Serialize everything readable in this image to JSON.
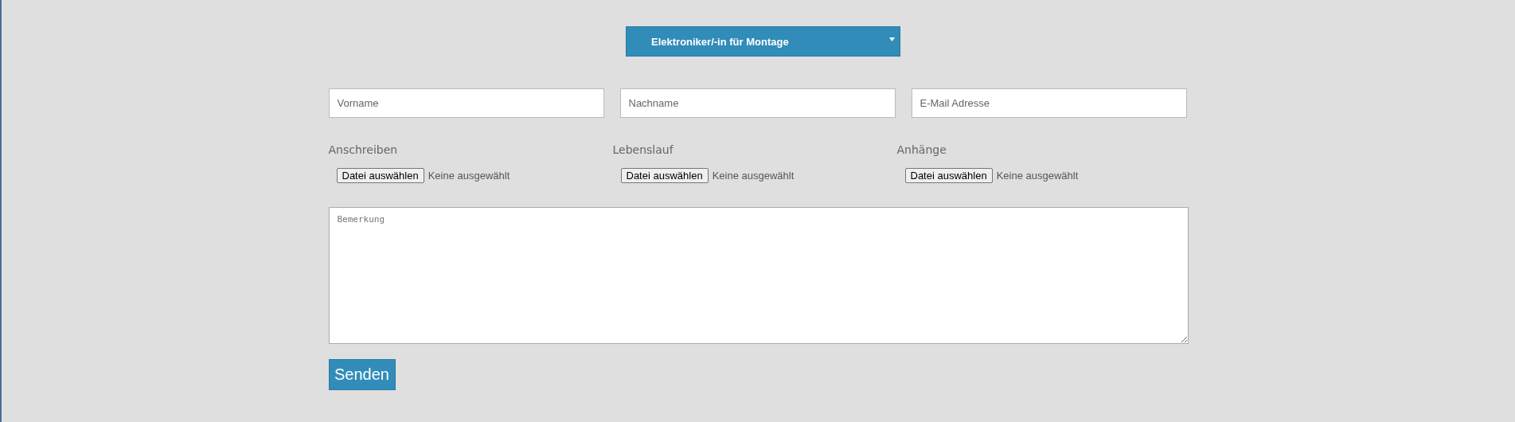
{
  "position_select": {
    "value": "Elektroniker/-in für Montage"
  },
  "fields": [
    {
      "placeholder": "Vorname"
    },
    {
      "placeholder": "Nachname"
    },
    {
      "placeholder": "E-Mail Adresse"
    }
  ],
  "uploads": [
    {
      "label": "Anschreiben",
      "button": "Datei auswählen",
      "status": "Keine ausgewählt"
    },
    {
      "label": "Lebenslauf",
      "button": "Datei auswählen",
      "status": "Keine ausgewählt"
    },
    {
      "label": "Anhänge",
      "button": "Datei auswählen",
      "status": "Keine ausgewählt"
    }
  ],
  "remark": {
    "placeholder": "Bemerkung"
  },
  "submit_button": "Senden"
}
